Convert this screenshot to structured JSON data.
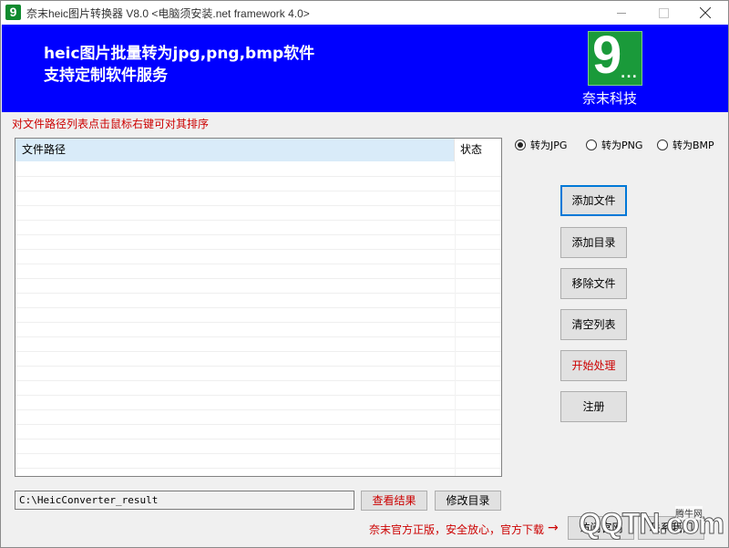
{
  "window": {
    "title": "奈末heic图片转换器 V8.0 <电脑须安装.net framework 4.0>",
    "app_icon_glyph": "9"
  },
  "banner": {
    "line1": "heic图片批量转为jpg,png,bmp软件",
    "line2": "支持定制软件服务",
    "logo_glyph": "9",
    "logo_dots": "...",
    "logo_caption": "奈末科技",
    "background": "#0000ff",
    "logo_color": "#1a9a3a"
  },
  "hint": "对文件路径列表点击鼠标右键可对其排序",
  "file_list": {
    "columns": [
      "文件路径",
      "状态"
    ],
    "rows": []
  },
  "format_options": [
    {
      "label": "转为JPG",
      "selected": true
    },
    {
      "label": "转为PNG",
      "selected": false
    },
    {
      "label": "转为BMP",
      "selected": false
    }
  ],
  "actions": {
    "add_file": "添加文件",
    "add_dir": "添加目录",
    "remove_file": "移除文件",
    "clear_list": "清空列表",
    "start": "开始处理",
    "register": "注册"
  },
  "output": {
    "path": "C:\\HeicConverter_result",
    "view_result": "查看结果",
    "change_dir": "修改目录"
  },
  "footer": {
    "note": "奈末官方正版，安全放心，官方下载",
    "arrow": "→",
    "official_site": "访问官网",
    "contact": "联系我们"
  },
  "watermark": {
    "text": "QQTN.com",
    "small": "腾牛网"
  },
  "colors": {
    "accent_red": "#cc0000",
    "selection_blue": "#d9ebf9"
  }
}
